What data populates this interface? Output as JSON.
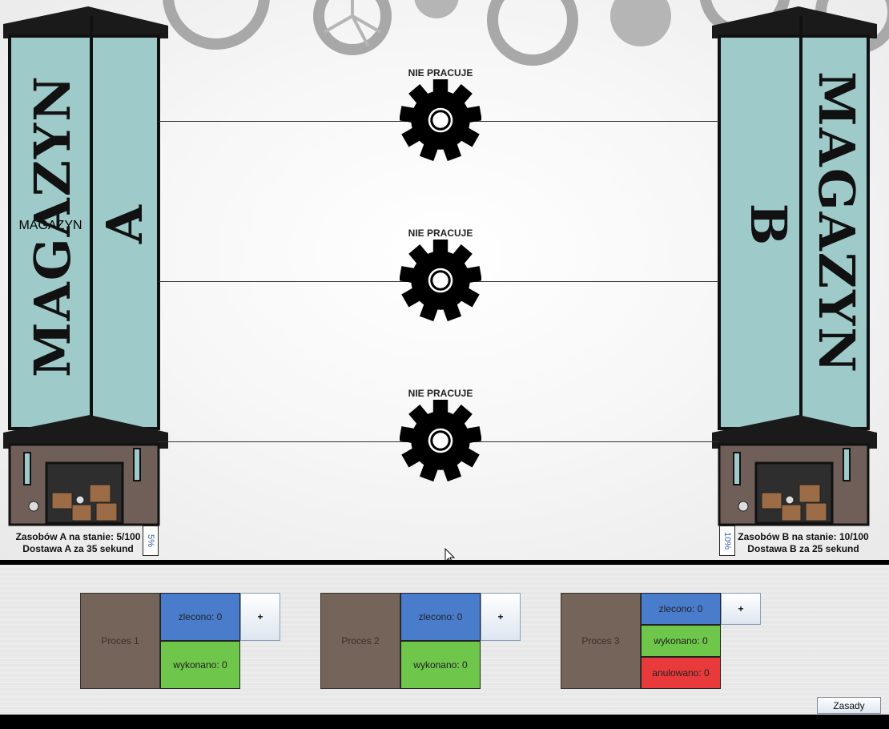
{
  "lanes": [
    {
      "status": "NIE PRACUJE"
    },
    {
      "status": "NIE PRACUJE"
    },
    {
      "status": "NIE PRACUJE"
    }
  ],
  "warehouse_a": {
    "word": "MAGAZYN",
    "letter": "A",
    "stock_text": "Zasobów A na stanie: 5/100",
    "delivery_text": "Dostawa A za 35 sekund",
    "percent": "5%"
  },
  "warehouse_b": {
    "word": "MAGAZYN",
    "letter": "B",
    "stock_text": "Zasobów B na stanie: 10/100",
    "delivery_text": "Dostawa B za 25 sekund",
    "percent": "10%"
  },
  "processes": [
    {
      "name": "Proces 1",
      "ordered": "zlecono: 0",
      "done": "wykonano: 0",
      "add": "+"
    },
    {
      "name": "Proces 2",
      "ordered": "zlecono: 0",
      "done": "wykonano: 0",
      "add": "+"
    },
    {
      "name": "Proces 3",
      "ordered": "zlecono: 0",
      "done": "wykonano: 0",
      "cancelled": "anulowano: 0",
      "add": "+"
    }
  ],
  "rules_button": "Zasady",
  "colors": {
    "tower": "#9ecbca",
    "process_box": "#756459",
    "ordered": "#4a7ccc",
    "done": "#6ec64a",
    "cancelled": "#e83a3a"
  }
}
